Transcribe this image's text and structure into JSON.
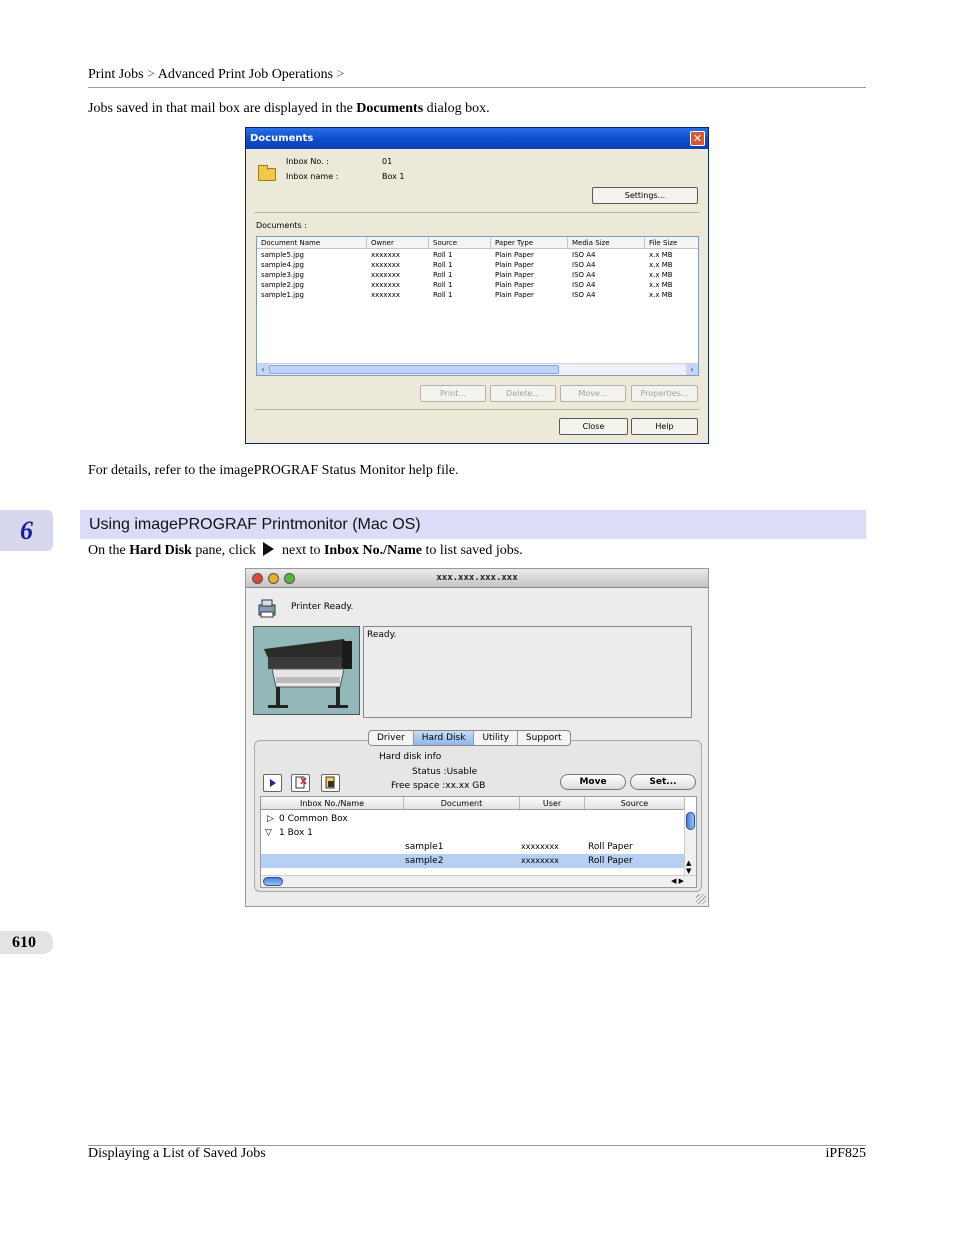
{
  "header": {
    "crumb1": "Print Jobs",
    "sep": ">",
    "crumb2": "Advanced Print Job Operations",
    "sep2": ">"
  },
  "para1": {
    "pre": "Jobs saved in that mail box are displayed in the ",
    "bold": "Documents",
    "post": " dialog box."
  },
  "win_dialog": {
    "title": "Documents",
    "inbox_no_label": "Inbox No. :",
    "inbox_no_value": "01",
    "inbox_name_label": "Inbox name :",
    "inbox_name_value": "Box 1",
    "settings_btn": "Settings...",
    "documents_label": "Documents :",
    "columns": [
      "Document Name",
      "Owner",
      "Source",
      "Paper Type",
      "Media Size",
      "File Size"
    ],
    "rows": [
      [
        "sample5.jpg",
        "xxxxxxx",
        "Roll 1",
        "Plain Paper",
        "ISO A4",
        "x.x MB"
      ],
      [
        "sample4.jpg",
        "xxxxxxx",
        "Roll 1",
        "Plain Paper",
        "ISO A4",
        "x.x MB"
      ],
      [
        "sample3.jpg",
        "xxxxxxx",
        "Roll 1",
        "Plain Paper",
        "ISO A4",
        "x.x MB"
      ],
      [
        "sample2.jpg",
        "xxxxxxx",
        "Roll 1",
        "Plain Paper",
        "ISO A4",
        "x.x MB"
      ],
      [
        "sample1.jpg",
        "xxxxxxx",
        "Roll 1",
        "Plain Paper",
        "ISO A4",
        "x.x MB"
      ]
    ],
    "print_btn": "Print...",
    "delete_btn": "Delete...",
    "move_btn": "Move...",
    "properties_btn": "Properties...",
    "close_btn": "Close",
    "help_btn": "Help"
  },
  "para2": "For details, refer to the imagePROGRAF Status Monitor help file.",
  "chapter_number": "6",
  "section_heading": "Using imagePROGRAF Printmonitor (Mac OS)",
  "para3": {
    "pre": "On the ",
    "bold1": "Hard Disk",
    "mid1": " pane, click ",
    "mid2": " next to ",
    "bold2": "Inbox No./Name",
    "post": " to list saved jobs."
  },
  "mac_window": {
    "title": "xxx.xxx.xxx.xxx",
    "status": "Printer Ready.",
    "ready_text": "Ready.",
    "tabs": [
      "Driver",
      "Hard Disk",
      "Utility",
      "Support"
    ],
    "selected_tab": "Hard Disk",
    "hd_info": "Hard disk info",
    "status_usable": "Status :Usable",
    "free_space": "Free space :xx.xx GB",
    "move_btn": "Move",
    "set_btn": "Set...",
    "columns": [
      "Inbox No./Name",
      "Document",
      "User",
      "Source"
    ],
    "tree": [
      {
        "label": "0 Common Box"
      },
      {
        "label": "1 Box 1"
      }
    ],
    "rows": [
      {
        "document": "sample1",
        "user": "xxxxxxxx",
        "source": "Roll Paper"
      },
      {
        "document": "sample2",
        "user": "xxxxxxxx",
        "source": "Roll Paper"
      }
    ]
  },
  "page_number": "610",
  "footer": {
    "left": "Displaying a List of Saved Jobs",
    "right": "iPF825"
  }
}
